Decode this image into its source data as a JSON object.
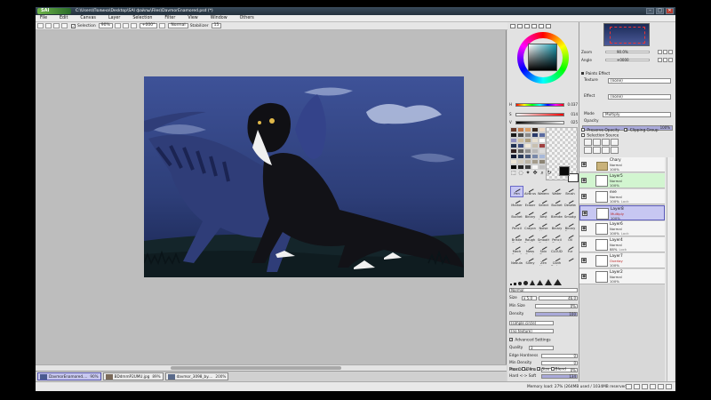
{
  "app": {
    "logo_text": "SAI",
    "title": "C:\\Users\\Полина\\Desktop\\SAI файлы\\Files\\DavmorEnamored.psd (*)"
  },
  "window_controls": {
    "minimize": "–",
    "maximize": "□",
    "close": "✕"
  },
  "menu": [
    "File",
    "Edit",
    "Canvas",
    "Layer",
    "Selection",
    "Filter",
    "View",
    "Window",
    "Others"
  ],
  "toolbar": {
    "selection_label": "Selection",
    "zoom": "90%",
    "rotation": "+000°",
    "mode": "Normal",
    "stabilizer_label": "Stabilizer",
    "stabilizer_value": "15"
  },
  "doc_tabs": [
    {
      "name": "DavmorEnamored....",
      "zoom": "90%",
      "active": true
    },
    {
      "name": "BDdmmP2UMU.jpg",
      "zoom": "89%",
      "active": false
    },
    {
      "name": "davmor_3098_by....",
      "zoom": "200%",
      "active": false
    }
  ],
  "status": {
    "memory": "Memory load: 27% (264MB used / 1034MB reserved)"
  },
  "colors": {
    "sliders": [
      {
        "label": "H",
        "value": "0.037"
      },
      {
        "label": "S",
        "value": "014"
      },
      {
        "label": "V",
        "value": "025"
      }
    ],
    "foreground": "#0a0a0a",
    "background": "#ffffff",
    "swatches": [
      "#6a3a2a",
      "#c47a4a",
      "#d9a06a",
      "#3a2a20",
      "#eedcc8",
      "#1a1a1a",
      "#4a4a4a",
      "#8a8a8a",
      "#2a3a6a",
      "#5a6aa0",
      "#9090c0",
      "#d0c0a0",
      "#b0a080",
      "#e8e0d0",
      "#ffffff",
      "#203050",
      "#405080",
      "#f0e8d8",
      "#c8c0b0",
      "#a04040",
      "#302020",
      "#606060",
      "#909090",
      "#b8b8b8",
      "#dcdcdc",
      "#101830",
      "#283858",
      "#485878",
      "#7888a8",
      "#a8b8d8",
      "#ece4d4",
      "#d4ccbc",
      "#bcb4a4",
      "#a49c8c",
      "#8c8474",
      "#000000",
      "#202020",
      "#404040",
      "#f8f8f8",
      "#c0c0c0"
    ]
  },
  "tools": [
    {
      "label": "Pen",
      "selected": true
    },
    {
      "label": "AirBrush"
    },
    {
      "label": "Watercolor"
    },
    {
      "label": "Water"
    },
    {
      "label": "Brush"
    },
    {
      "label": "Marker"
    },
    {
      "label": "Eraser"
    },
    {
      "label": "Select"
    },
    {
      "label": "Bucket"
    },
    {
      "label": "Deselect"
    },
    {
      "label": "Bucket"
    },
    {
      "label": "Binary"
    },
    {
      "label": "Best Acrylic"
    },
    {
      "label": "Blender"
    },
    {
      "label": "Smudge"
    },
    {
      "label": "Pencil"
    },
    {
      "label": "Crayon"
    },
    {
      "label": "Noise Lines"
    },
    {
      "label": "Binary"
    },
    {
      "label": "Binary Eraser"
    },
    {
      "label": "Bristle Brush"
    },
    {
      "label": "Rough Textured"
    },
    {
      "label": "Smooth Brush"
    },
    {
      "label": "Pencil Brush"
    },
    {
      "label": "Oil"
    },
    {
      "label": "Mech Pencil"
    },
    {
      "label": "Mess Brush"
    },
    {
      "label": "Skin Tone"
    },
    {
      "label": "CLOUDS"
    },
    {
      "label": "Fur"
    },
    {
      "label": "Nebula"
    },
    {
      "label": "Slimy"
    },
    {
      "label": "Zen Lines"
    },
    {
      "label": "Cloth Texture"
    },
    {
      "label": ""
    }
  ],
  "brush": {
    "blend_mode": "Normal",
    "size_label": "Size",
    "size_mult": "x 5.0",
    "size_value": "46.0",
    "min_size_label": "Min Size",
    "min_size_value": "0%",
    "density_label": "Density",
    "density_value": "100",
    "shape": "(simple circle)",
    "texture": "(no texture)",
    "advanced_label": "Advanced Settings",
    "quality_label": "Quality",
    "quality_value": "3",
    "edge_label": "Edge Hardness",
    "edge_value": "0",
    "min_density_label": "Min Density",
    "min_density_value": "0",
    "max_dens_label": "Max Dens Prs.",
    "max_dens_value": "0%",
    "hard_soft_label": "Hard <-> Soft",
    "hard_soft_value": "134",
    "press_label": "Press:",
    "press_dens": "Dens",
    "press_size": "Size",
    "press_blend": "Blend"
  },
  "navigator": {
    "zoom_label": "Zoom",
    "zoom_value": "90.0%",
    "angle_label": "Angle",
    "angle_value": "+0000"
  },
  "paint_effect": {
    "title": "Paints Effect",
    "texture_label": "Texture",
    "texture_value": "(none)",
    "effect_label": "Effect",
    "effect_value": "(none)"
  },
  "layer_props": {
    "mode_label": "Mode",
    "mode_value": "Multiply",
    "opacity_label": "Opacity",
    "opacity_value": "100%",
    "preserve_label": "Preserve Opacity",
    "clipping_label": "Clipping Group",
    "selection_source_label": "Selection Source"
  },
  "layers": [
    {
      "name": "Chary",
      "mode": "Normal",
      "opacity": "100%",
      "type": "folder",
      "style": ""
    },
    {
      "name": "Layer5",
      "mode": "Normal",
      "opacity": "100%",
      "type": "layer",
      "style": "green"
    },
    {
      "name": "eve",
      "mode": "Normal",
      "opacity": "100%",
      "lock": "Lock",
      "type": "layer",
      "style": ""
    },
    {
      "name": "Layer8",
      "mode": "Multiply",
      "opacity": "100%",
      "type": "layer",
      "style": "selected"
    },
    {
      "name": "Layer6",
      "mode": "Normal",
      "opacity": "100%",
      "lock": "Lock",
      "type": "layer",
      "style": ""
    },
    {
      "name": "Layer4",
      "mode": "Normal",
      "opacity": "88%",
      "lock": "Lock",
      "type": "layer",
      "style": ""
    },
    {
      "name": "Layer7",
      "mode": "Overlay",
      "opacity": "100%",
      "type": "layer",
      "style": ""
    },
    {
      "name": "Layer2",
      "mode": "Normal",
      "opacity": "100%",
      "type": "layer",
      "style": ""
    }
  ],
  "canvas_colors": {
    "sky_top": "#3d4f90",
    "sky_bottom": "#1d2a55",
    "ground": "#14252a",
    "creature_dark": "#121217",
    "creature_blue": "#2f3d78"
  }
}
